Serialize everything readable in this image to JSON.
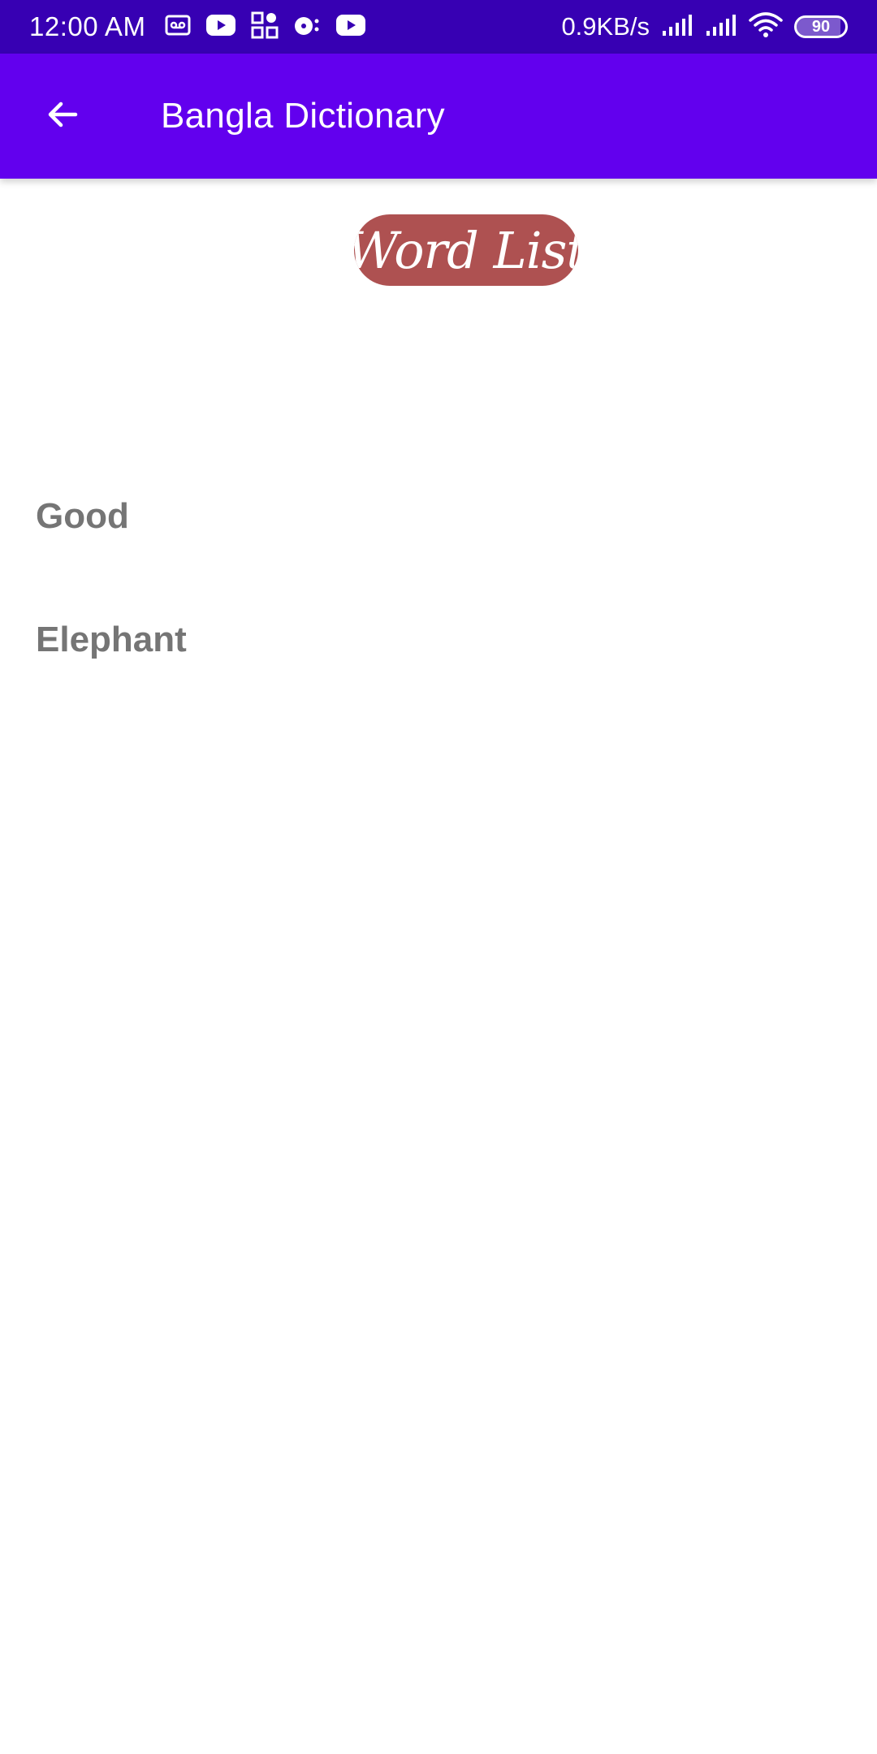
{
  "status_bar": {
    "time": "12:00 AM",
    "icons_left": [
      "voicemail-icon",
      "youtube-icon",
      "apps-grid-icon",
      "music-disc-icon",
      "youtube-icon"
    ],
    "net_speed": "0.9KB/s",
    "battery_level": "90",
    "battery_fraction": 0.9,
    "bg_color": "#3700b3"
  },
  "app_bar": {
    "title": "Bangla Dictionary",
    "back_icon": "arrow-back-icon",
    "bg_color": "#6200ee"
  },
  "badge": {
    "label": "Word List",
    "bg_color": "#ae5151"
  },
  "words": [
    {
      "label": "Good"
    },
    {
      "label": "Elephant"
    }
  ]
}
